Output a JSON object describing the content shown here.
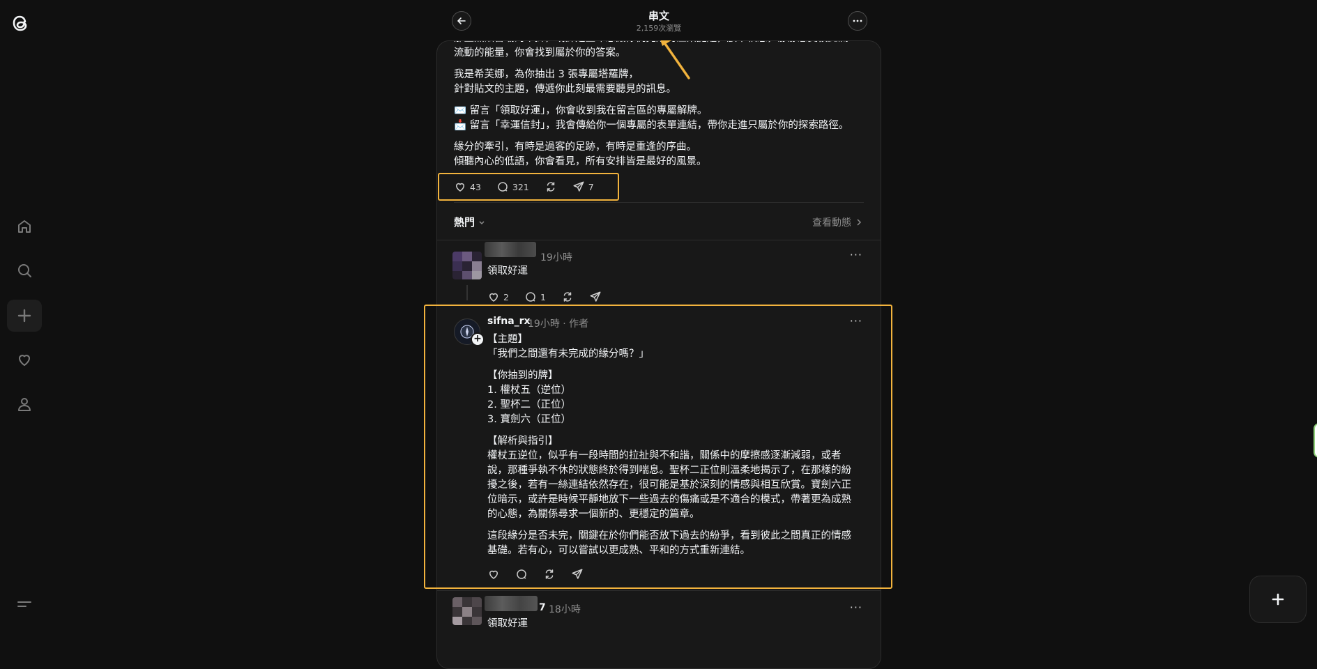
{
  "header": {
    "title": "串文",
    "views": "2,159次瀏覽"
  },
  "post": {
    "cut_line": "那些無法言喻的牽掛，或許是生命想讓你們完成的溫柔提醒，放下執念，靜靜感受彼此流",
    "lines": [
      "流動的能量，你會找到屬於你的答案。",
      "我是希芙娜，為你抽出 3 張專屬塔羅牌，",
      "針對貼文的主題，傳遞你此刻最需要聽見的訊息。",
      "留言「領取好運」，你會收到我在留言區的專屬解牌。",
      "留言「幸運信封」，我會傳給你一個專屬的表單連結，帶你走進只屬於你的探索路徑。",
      "緣分的牽引，有時是過客的足跡，有時是重逢的序曲。",
      "傾聽內心的低語，你會看見，所有安排皆是最好的風景。"
    ],
    "likes": "43",
    "comments": "321",
    "shares": "7"
  },
  "sort": {
    "label": "熱門",
    "activity": "查看動態"
  },
  "reply1": {
    "time": "19小時",
    "text": "領取好運",
    "likes": "2",
    "comments": "1"
  },
  "author_reply": {
    "username": "sifna_rx",
    "meta": "19小時 · 作者",
    "paragraphs": [
      [
        "【主題】",
        "「我們之間還有未完成的緣分嗎？」"
      ],
      [
        "【你抽到的牌】",
        "1. 權杖五（逆位）",
        "2. 聖杯二（正位）",
        "3. 寶劍六（正位）"
      ],
      [
        "【解析與指引】",
        "權杖五逆位，似乎有一段時間的拉扯與不和諧，關係中的摩擦感逐漸減弱，或者",
        "說，那種爭執不休的狀態終於得到喘息。聖杯二正位則溫柔地揭示了，在那樣的紛",
        "擾之後，若有一絲連結依然存在，很可能是基於深刻的情感與相互欣賞。寶劍六正",
        "位暗示，或許是時候平靜地放下一些過去的傷痛或是不適合的模式，帶著更為成熟",
        "的心態，為關係尋求一個新的、更穩定的篇章。"
      ],
      [
        "這段緣分是否未完，關鍵在於你們能否放下過去的紛爭，看到彼此之間真正的情感",
        "基礎。若有心，可以嘗試以更成熟、平和的方式重新連結。"
      ]
    ]
  },
  "reply3": {
    "name_suffix": "7",
    "time": "18小時",
    "text": "領取好運"
  },
  "colors": {
    "accent_highlight": "#f2b33d",
    "background": "#101010",
    "card": "#181818"
  },
  "icons": [
    "threads-logo-icon",
    "home-icon",
    "search-icon",
    "create-icon",
    "heart-icon",
    "profile-icon",
    "menu-icon",
    "back-arrow-icon",
    "more-icon",
    "like-icon",
    "comment-icon",
    "repost-icon",
    "share-icon",
    "chevron-down-icon",
    "chevron-right-icon",
    "plus-icon"
  ]
}
